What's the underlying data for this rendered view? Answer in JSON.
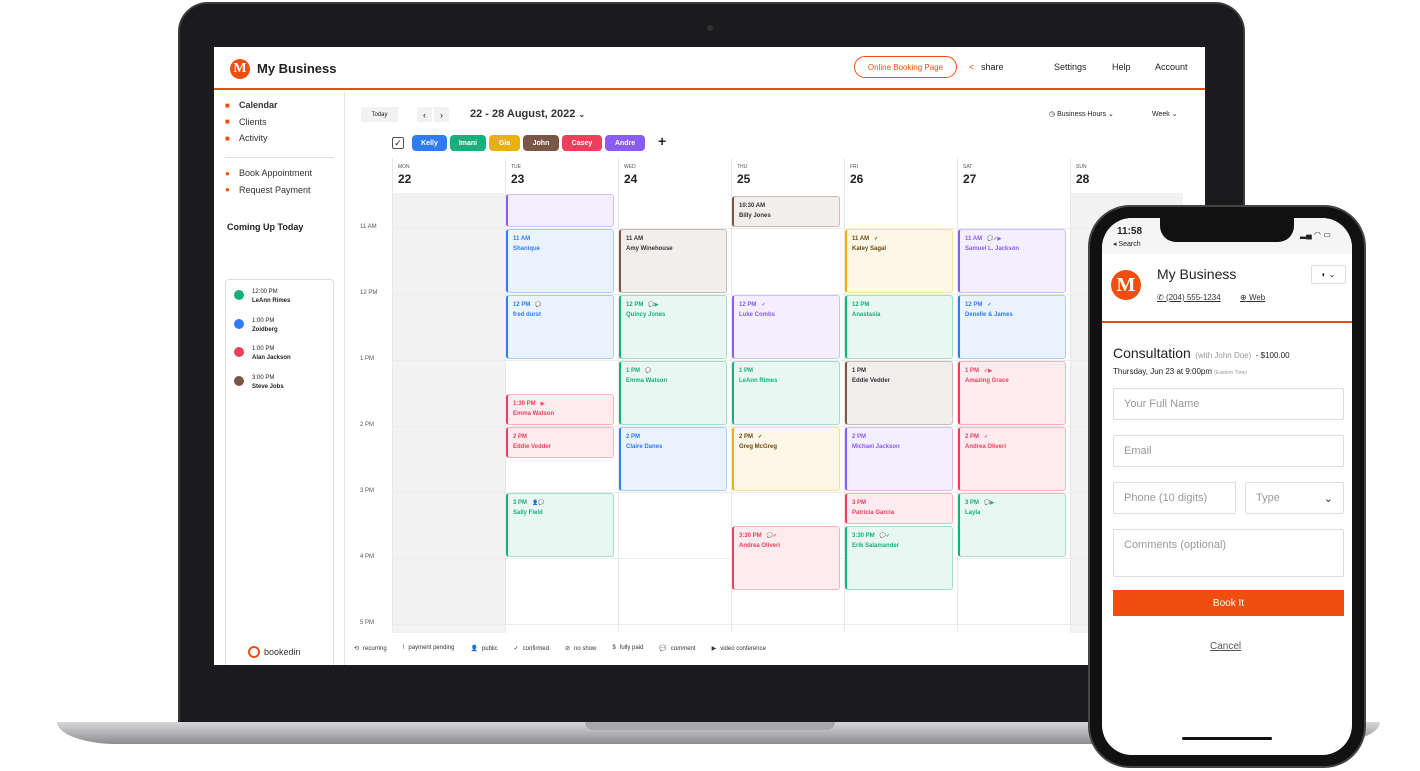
{
  "app": {
    "title": "My Business",
    "logo_letter": "M",
    "accent": "#f04e0f"
  },
  "topnav": {
    "booking_page": "Online Booking Page",
    "share": "share",
    "settings": "Settings",
    "help": "Help",
    "account": "Account"
  },
  "sidebar": {
    "items": [
      {
        "label": "Calendar",
        "icon": "calendar-icon"
      },
      {
        "label": "Clients",
        "icon": "clients-icon"
      },
      {
        "label": "Activity",
        "icon": "bell-icon"
      }
    ],
    "actions": [
      {
        "label": "Book Appointment",
        "icon": "plus-circle-icon"
      },
      {
        "label": "Request Payment",
        "icon": "money-icon"
      }
    ],
    "coming_title": "Coming Up Today",
    "coming": [
      {
        "time": "12:00 PM",
        "name": "LeAnn Rimes",
        "color": "#16b07a"
      },
      {
        "time": "1:00 PM",
        "name": "Zoidberg",
        "color": "#2f7cf6"
      },
      {
        "time": "1:00 PM",
        "name": "Alan Jackson",
        "color": "#ef3e5c"
      },
      {
        "time": "3:00 PM",
        "name": "Steve Jobs",
        "color": "#7a5646"
      }
    ],
    "brand": "bookedin"
  },
  "toolbar": {
    "today": "Today",
    "range": "22 - 28 August, 2022",
    "hours": "Business Hours",
    "view": "Week"
  },
  "staff": [
    {
      "name": "Kelly",
      "color": "#2f7cf6"
    },
    {
      "name": "Imani",
      "color": "#16b07a"
    },
    {
      "name": "Gia",
      "color": "#e9b10c"
    },
    {
      "name": "John",
      "color": "#7a5646"
    },
    {
      "name": "Casey",
      "color": "#ef3e5c"
    },
    {
      "name": "Andre",
      "color": "#8a5cf6"
    }
  ],
  "days": [
    {
      "dow": "MON",
      "num": "22",
      "closed": true
    },
    {
      "dow": "TUE",
      "num": "23"
    },
    {
      "dow": "WED",
      "num": "24"
    },
    {
      "dow": "THU",
      "num": "25"
    },
    {
      "dow": "FRI",
      "num": "26"
    },
    {
      "dow": "SAT",
      "num": "27"
    },
    {
      "dow": "SUN",
      "num": "28",
      "closed": true
    }
  ],
  "time_labels": [
    "11 AM",
    "12 PM",
    "1 PM",
    "2 PM",
    "3 PM",
    "4 PM",
    "5 PM"
  ],
  "events": [
    {
      "day": 1,
      "start": 10.0,
      "end": 11,
      "time": "",
      "name": "",
      "staff": "Andre",
      "icons": ""
    },
    {
      "day": 1,
      "start": 11,
      "end": 12,
      "time": "11 AM",
      "name": "Shanique",
      "staff": "Kelly",
      "icons": ""
    },
    {
      "day": 1,
      "start": 12,
      "end": 13,
      "time": "12 PM",
      "name": "fred durst",
      "staff": "Kelly",
      "icons": "💬"
    },
    {
      "day": 1,
      "start": 13.5,
      "end": 14,
      "time": "1:30 PM",
      "name": "Emma Watson",
      "staff": "Casey",
      "icons": "▶"
    },
    {
      "day": 1,
      "start": 14,
      "end": 14.5,
      "time": "2 PM",
      "name": "Eddie Vedder",
      "staff": "Casey",
      "icons": ""
    },
    {
      "day": 1,
      "start": 15,
      "end": 16,
      "time": "3 PM",
      "name": "Sally Field",
      "staff": "Imani",
      "icons": "👤💬"
    },
    {
      "day": 2,
      "start": 11,
      "end": 12,
      "time": "11 AM",
      "name": "Amy Winehouse",
      "staff": "John",
      "icons": ""
    },
    {
      "day": 2,
      "start": 12,
      "end": 13,
      "time": "12 PM",
      "name": "Quincy Jones",
      "staff": "Imani",
      "icons": "💬▶"
    },
    {
      "day": 2,
      "start": 13,
      "end": 14,
      "time": "1 PM",
      "name": "Emma Watson",
      "staff": "Imani",
      "icons": "💬"
    },
    {
      "day": 2,
      "start": 14,
      "end": 15,
      "time": "2 PM",
      "name": "Claire Danes",
      "staff": "Kelly",
      "icons": ""
    },
    {
      "day": 3,
      "start": 10.5,
      "end": 11,
      "time": "10:30 AM",
      "name": "Billy Jones",
      "staff": "John",
      "icons": ""
    },
    {
      "day": 3,
      "start": 12,
      "end": 13,
      "time": "12 PM",
      "name": "Luke Combs",
      "staff": "Andre",
      "icons": "✓"
    },
    {
      "day": 3,
      "start": 13,
      "end": 14,
      "time": "1 PM",
      "name": "LeAnn Rimes",
      "staff": "Imani",
      "icons": ""
    },
    {
      "day": 3,
      "start": 14,
      "end": 15,
      "time": "2 PM",
      "name": "Greg McGreg",
      "staff": "Gia",
      "icons": "✓"
    },
    {
      "day": 3,
      "start": 15.5,
      "end": 16.5,
      "time": "3:30 PM",
      "name": "Andrea Oliveri",
      "staff": "Casey",
      "icons": "💬✓"
    },
    {
      "day": 4,
      "start": 11,
      "end": 12,
      "time": "11 AM",
      "name": "Katey Sagal",
      "staff": "Gia",
      "icons": "✓"
    },
    {
      "day": 4,
      "start": 12,
      "end": 13,
      "time": "12 PM",
      "name": "Anastasia",
      "staff": "Imani",
      "icons": ""
    },
    {
      "day": 4,
      "start": 13,
      "end": 14,
      "time": "1 PM",
      "name": "Eddie Vedder",
      "staff": "John",
      "icons": ""
    },
    {
      "day": 4,
      "start": 14,
      "end": 15,
      "time": "2 PM",
      "name": "Michael Jackson",
      "staff": "Andre",
      "icons": ""
    },
    {
      "day": 4,
      "start": 15,
      "end": 15.5,
      "time": "3 PM",
      "name": "Patricia Garcia",
      "staff": "Casey",
      "icons": ""
    },
    {
      "day": 4,
      "start": 15.5,
      "end": 16.5,
      "time": "3:30 PM",
      "name": "Erik Salamander",
      "staff": "Imani",
      "icons": "💬✓"
    },
    {
      "day": 5,
      "start": 11,
      "end": 12,
      "time": "11 AM",
      "name": "Samuel L. Jackson",
      "staff": "Andre",
      "icons": "💬✓▶"
    },
    {
      "day": 5,
      "start": 12,
      "end": 13,
      "time": "12 PM",
      "name": "Denelle & James",
      "staff": "Kelly",
      "icons": "✓"
    },
    {
      "day": 5,
      "start": 13,
      "end": 14,
      "time": "1 PM",
      "name": "Amazing Grace",
      "staff": "Casey",
      "icons": "✓▶"
    },
    {
      "day": 5,
      "start": 14,
      "end": 15,
      "time": "2 PM",
      "name": "Andrea Oliveri",
      "staff": "Casey",
      "icons": "✓"
    },
    {
      "day": 5,
      "start": 15,
      "end": 16,
      "time": "3 PM",
      "name": "Layla",
      "staff": "Imani",
      "icons": "💬▶"
    }
  ],
  "legend": [
    {
      "icon": "⟲",
      "label": "recurring"
    },
    {
      "icon": "!",
      "label": "payment pending"
    },
    {
      "icon": "👤",
      "label": "public"
    },
    {
      "icon": "✓",
      "label": "confirmed"
    },
    {
      "icon": "⊘",
      "label": "no show"
    },
    {
      "icon": "$",
      "label": "fully paid"
    },
    {
      "icon": "💬",
      "label": "comment"
    },
    {
      "icon": "▶",
      "label": "video conference"
    }
  ],
  "phone": {
    "clock": "11:58",
    "back": "◂ Search",
    "business": "My Business",
    "phone": "(204) 555-1234",
    "web": "Web",
    "service": "Consultation",
    "with": "(with John Doe)",
    "price": "- $100.00",
    "when": "Thursday, Jun 23 at 9:00pm",
    "tz": "(Eastern Time)",
    "name_ph": "Your Full Name",
    "email_ph": "Email",
    "phone_ph": "Phone (10 digits)",
    "type_ph": "Type",
    "comments_ph": "Comments (optional)",
    "book": "Book It",
    "cancel": "Cancel"
  }
}
